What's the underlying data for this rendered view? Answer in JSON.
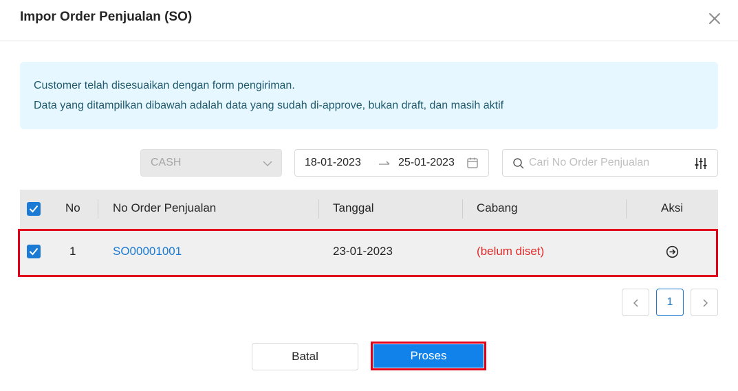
{
  "modal": {
    "title": "Impor Order Penjualan (SO)",
    "close_icon": "close-icon"
  },
  "info": {
    "line1": "Customer telah disesuaikan dengan form pengiriman.",
    "line2": "Data yang ditampilkan dibawah adalah data yang sudah di-approve, bukan draft, dan masih aktif"
  },
  "filters": {
    "payment_type": "CASH",
    "date_start": "18-01-2023",
    "date_end": "25-01-2023",
    "search_placeholder": "Cari No Order Penjualan",
    "search_value": ""
  },
  "table": {
    "headers": {
      "no": "No",
      "order_no": "No Order Penjualan",
      "date": "Tanggal",
      "branch": "Cabang",
      "action": "Aksi"
    },
    "header_checked": true,
    "rows": [
      {
        "checked": true,
        "no": "1",
        "order_no": "SO00001001",
        "date": "23-01-2023",
        "branch": "(belum diset)"
      }
    ]
  },
  "pagination": {
    "current_page": "1"
  },
  "footer": {
    "cancel_label": "Batal",
    "process_label": "Proses"
  },
  "colors": {
    "primary": "#1182ea",
    "link": "#1b7ad3",
    "warning_text": "#e02a2a",
    "highlight": "#e0001a",
    "info_bg": "#e6f7ff"
  }
}
